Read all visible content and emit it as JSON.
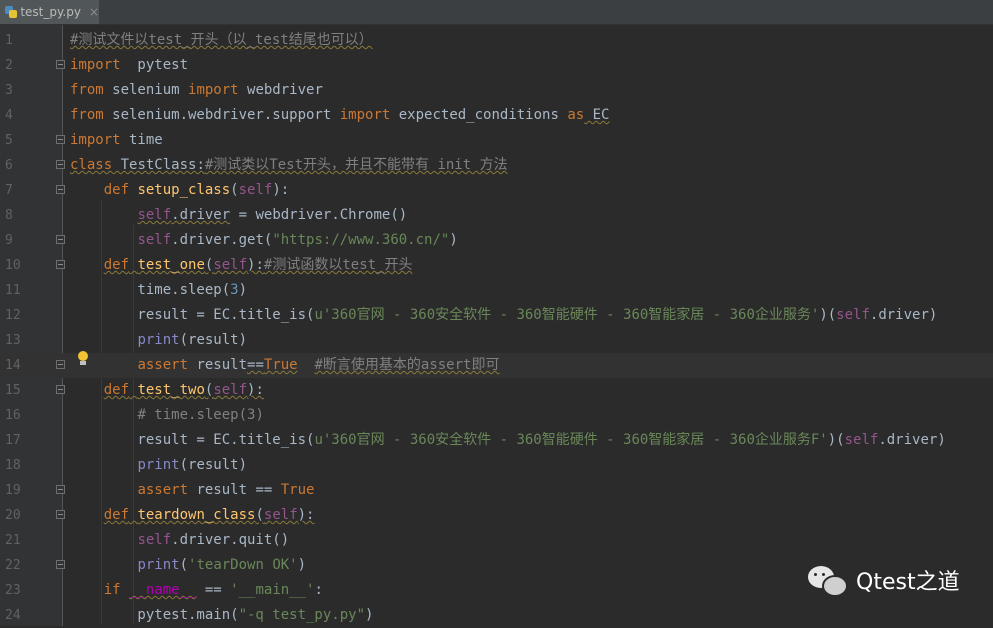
{
  "tab": {
    "label": "test_py.py",
    "close": "×"
  },
  "colors": {
    "background": "#2b2b2b",
    "gutter": "#313335",
    "keyword": "#cc7832",
    "comment": "#808080",
    "string": "#6a8759",
    "self": "#94558d",
    "function": "#ffc66d",
    "builtin": "#8888c6",
    "dunder": "#b200b2",
    "number": "#6897bb"
  },
  "editor": {
    "current_line": 14,
    "lines": [
      {
        "n": "1",
        "fold": false,
        "tokens": [
          [
            "cm wavy",
            "#测试文件以test_开头（以_test结尾也可以）"
          ]
        ]
      },
      {
        "n": "2",
        "fold": true,
        "tokens": [
          [
            "kw",
            "import"
          ],
          [
            "",
            "  pytest"
          ]
        ]
      },
      {
        "n": "3",
        "fold": false,
        "tokens": [
          [
            "kw",
            "from"
          ],
          [
            "",
            " selenium "
          ],
          [
            "kw",
            "import"
          ],
          [
            "",
            " webdriver"
          ]
        ]
      },
      {
        "n": "4",
        "fold": false,
        "tokens": [
          [
            "kw",
            "from"
          ],
          [
            "",
            " selenium.webdriver.support "
          ],
          [
            "kw",
            "import"
          ],
          [
            "",
            " expected_conditions "
          ],
          [
            "kw",
            "as"
          ],
          [
            "wavy",
            " EC"
          ]
        ]
      },
      {
        "n": "5",
        "fold": true,
        "tokens": [
          [
            "kw",
            "import"
          ],
          [
            "",
            " time"
          ]
        ]
      },
      {
        "n": "6",
        "fold": true,
        "tokens": [
          [
            "kw wavy",
            "class"
          ],
          [
            "wavy",
            " TestClass:"
          ],
          [
            "cm wavy",
            "#测试类以Test开头，并且不能带有 init 方法"
          ]
        ]
      },
      {
        "n": "7",
        "fold": true,
        "tokens": [
          [
            "",
            "    "
          ],
          [
            "kw",
            "def"
          ],
          [
            "",
            " "
          ],
          [
            "fn",
            "setup_class"
          ],
          [
            "",
            "("
          ],
          [
            "sf",
            "self"
          ],
          [
            "",
            "):"
          ]
        ]
      },
      {
        "n": "8",
        "fold": false,
        "tokens": [
          [
            "",
            "        "
          ],
          [
            "sf wavy",
            "self"
          ],
          [
            "wavy",
            ".driver"
          ],
          [
            "",
            " = webdriver.Chrome()"
          ]
        ]
      },
      {
        "n": "9",
        "fold": true,
        "tokens": [
          [
            "",
            "        "
          ],
          [
            "sf",
            "self"
          ],
          [
            "",
            ".driver.get("
          ],
          [
            "st",
            "\"https://www.360.cn/\""
          ],
          [
            "",
            ")"
          ]
        ]
      },
      {
        "n": "10",
        "fold": true,
        "tokens": [
          [
            "",
            "    "
          ],
          [
            "kw wavy",
            "def"
          ],
          [
            "wavy",
            " "
          ],
          [
            "fn wavy",
            "test_one"
          ],
          [
            "wavy",
            "("
          ],
          [
            "sf wavy",
            "self"
          ],
          [
            "wavy",
            "):"
          ],
          [
            "cm wavy",
            "#测试函数以test_开头"
          ]
        ]
      },
      {
        "n": "11",
        "fold": false,
        "tokens": [
          [
            "",
            "        time.sleep("
          ],
          [
            "nm",
            "3"
          ],
          [
            "",
            ")"
          ]
        ]
      },
      {
        "n": "12",
        "fold": false,
        "tokens": [
          [
            "",
            "        result = EC.title_is("
          ],
          [
            "st",
            "u'360官网 - 360安全软件 - 360智能硬件 - 360智能家居 - 360企业服务'"
          ],
          [
            "",
            ")("
          ],
          [
            "sf",
            "self"
          ],
          [
            "",
            ".driver)"
          ]
        ]
      },
      {
        "n": "13",
        "fold": false,
        "tokens": [
          [
            "",
            "        "
          ],
          [
            "bi",
            "print"
          ],
          [
            "",
            "(result)"
          ]
        ]
      },
      {
        "n": "14",
        "fold": true,
        "tokens": [
          [
            "",
            "        "
          ],
          [
            "kw",
            "assert"
          ],
          [
            "",
            " result"
          ],
          [
            "wavy",
            "=="
          ],
          [
            "kw wavy",
            "True"
          ],
          [
            "",
            "  "
          ],
          [
            "cm wavy",
            "#断言使用基本的assert即可"
          ]
        ]
      },
      {
        "n": "15",
        "fold": true,
        "tokens": [
          [
            "",
            "    "
          ],
          [
            "kw wavy",
            "def"
          ],
          [
            "wavy",
            " "
          ],
          [
            "fn wavy",
            "test_two"
          ],
          [
            "wavy",
            "("
          ],
          [
            "sf wavy",
            "self"
          ],
          [
            "wavy",
            "):"
          ]
        ]
      },
      {
        "n": "16",
        "fold": false,
        "tokens": [
          [
            "",
            "        "
          ],
          [
            "cm",
            "# time.sleep(3)"
          ]
        ]
      },
      {
        "n": "17",
        "fold": false,
        "tokens": [
          [
            "",
            "        result = EC.title_is("
          ],
          [
            "st",
            "u'360官网 - 360安全软件 - 360智能硬件 - 360智能家居 - 360企业服务F'"
          ],
          [
            "",
            ")("
          ],
          [
            "sf",
            "self"
          ],
          [
            "",
            ".driver)"
          ]
        ]
      },
      {
        "n": "18",
        "fold": false,
        "tokens": [
          [
            "",
            "        "
          ],
          [
            "bi",
            "print"
          ],
          [
            "",
            "(result)"
          ]
        ]
      },
      {
        "n": "19",
        "fold": true,
        "tokens": [
          [
            "",
            "        "
          ],
          [
            "kw",
            "assert"
          ],
          [
            "",
            " result == "
          ],
          [
            "kw",
            "True"
          ]
        ]
      },
      {
        "n": "20",
        "fold": true,
        "tokens": [
          [
            "",
            "    "
          ],
          [
            "kw wavy",
            "def"
          ],
          [
            "wavy",
            " "
          ],
          [
            "fn wavy",
            "teardown_class"
          ],
          [
            "wavy",
            "("
          ],
          [
            "sf wavy",
            "self"
          ],
          [
            "wavy",
            "):"
          ]
        ]
      },
      {
        "n": "21",
        "fold": false,
        "tokens": [
          [
            "",
            "        "
          ],
          [
            "sf",
            "self"
          ],
          [
            "",
            ".driver.quit()"
          ]
        ]
      },
      {
        "n": "22",
        "fold": true,
        "tokens": [
          [
            "",
            "        "
          ],
          [
            "bi",
            "print"
          ],
          [
            "",
            "("
          ],
          [
            "st",
            "'tearDown OK'"
          ],
          [
            "",
            ")"
          ]
        ]
      },
      {
        "n": "23",
        "fold": false,
        "tokens": [
          [
            "",
            "    "
          ],
          [
            "kw",
            "if"
          ],
          [
            "",
            " "
          ],
          [
            "dd wavy",
            "__name__"
          ],
          [
            "",
            " == "
          ],
          [
            "st",
            "'__main__'"
          ],
          [
            "",
            ":"
          ]
        ]
      },
      {
        "n": "24",
        "fold": false,
        "tokens": [
          [
            "",
            "        pytest.main("
          ],
          [
            "st",
            "\"-q test_py.py\""
          ],
          [
            "",
            ")"
          ]
        ]
      }
    ]
  },
  "watermark": {
    "text": "Qtest之道",
    "icon": "wechat-icon"
  }
}
